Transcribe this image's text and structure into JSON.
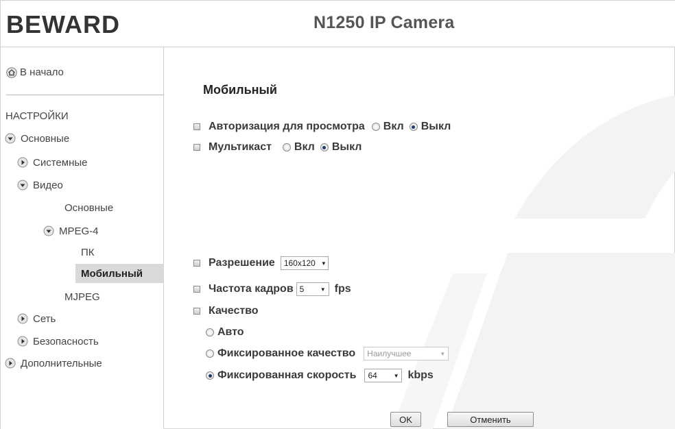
{
  "header": {
    "logo_text": "BEWARD",
    "camera_title": "N1250 IP Camera"
  },
  "sidebar": {
    "home_label": "В начало",
    "section_title": "НАСТРОЙКИ",
    "items": [
      {
        "label": "Основные"
      },
      {
        "label": "Системные"
      },
      {
        "label": "Видео"
      },
      {
        "label": "Основные"
      },
      {
        "label": "MPEG-4"
      },
      {
        "label": "ПК"
      },
      {
        "label": "Мобильный",
        "active": true
      },
      {
        "label": "MJPEG"
      },
      {
        "label": "Сеть"
      },
      {
        "label": "Безопасность"
      },
      {
        "label": "Дополнительные"
      }
    ]
  },
  "main": {
    "page_title": "Мобильный",
    "auth": {
      "label": "Авторизация для просмотра",
      "on": "Вкл",
      "off": "Выкл",
      "selected": "off"
    },
    "multicast": {
      "label": "Мультикаст",
      "on": "Вкл",
      "off": "Выкл",
      "selected": "off"
    },
    "resolution": {
      "label": "Разрешение",
      "value": "160x120"
    },
    "framerate": {
      "label": "Частота кадров",
      "value": "5",
      "unit": "fps"
    },
    "quality": {
      "label": "Качество",
      "auto_label": "Авто",
      "fixed_quality_label": "Фиксированное качество",
      "fixed_quality_value": "Наилучшее",
      "fixed_rate_label": "Фиксированная скорость",
      "fixed_rate_value": "64",
      "fixed_rate_unit": "kbps",
      "selected": "fixed_rate"
    },
    "buttons": {
      "ok": "OK",
      "cancel": "Отменить"
    }
  },
  "colors": {
    "logo": "#333333",
    "title": "#555555",
    "active_nav_bg": "#d9d9d9",
    "radio_dot": "#1e3a66",
    "watermark": "#f2f2f2"
  }
}
